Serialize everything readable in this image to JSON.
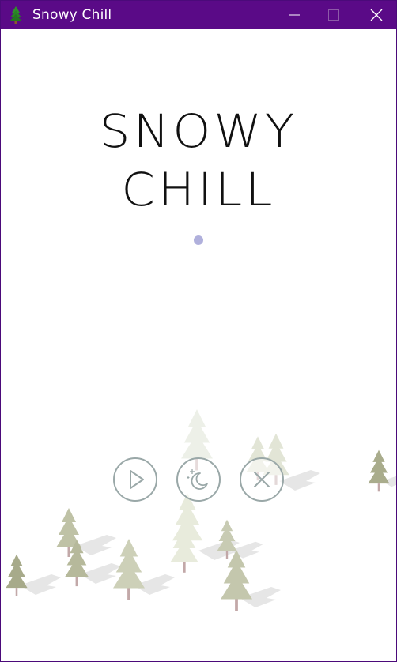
{
  "window": {
    "title": "Snowy Chill",
    "app_icon": "pine-tree-icon",
    "controls": [
      "minimize-icon",
      "maximize-icon",
      "close-icon"
    ]
  },
  "game": {
    "logo_line1": "SNOWY",
    "logo_line2": "CHILL",
    "buttons": [
      {
        "name": "play",
        "icon": "play-icon"
      },
      {
        "name": "night-mode",
        "icon": "moon-stars-icon"
      },
      {
        "name": "quit",
        "icon": "x-circle-icon"
      }
    ],
    "colors": {
      "titlebar": "#5a0a87",
      "button_stroke": "#9aa8a8",
      "dot": "#b0b0dc",
      "tree": "#c9ccb4",
      "tree_dark": "#a8ab8e",
      "trunk": "#b89c9c"
    }
  }
}
